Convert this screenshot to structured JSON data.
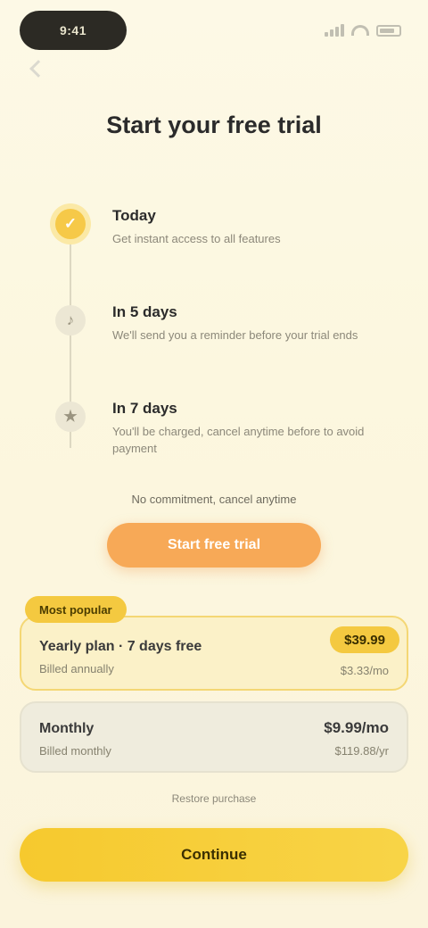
{
  "status_bar": {
    "time": "9:41"
  },
  "title": "Start your free trial",
  "timeline": [
    {
      "icon": "lock-icon",
      "glyph": "✓",
      "title": "Today",
      "desc": "Get instant access to all features",
      "active": true
    },
    {
      "icon": "bell-icon",
      "glyph": "♪",
      "title": "In 5 days",
      "desc": "We'll send you a reminder before your trial ends",
      "active": false
    },
    {
      "icon": "star-icon",
      "glyph": "★",
      "title": "In 7 days",
      "desc": "You'll be charged, cancel anytime before to avoid payment",
      "active": false
    }
  ],
  "note": "No commitment, cancel anytime",
  "cta_label": "Start free trial",
  "plans": {
    "tag": "Most popular",
    "selected": {
      "name": "Yearly plan · 7 days free",
      "sub": "Billed annually",
      "price": "$39.99",
      "price_sub": "$3.33/mo"
    },
    "regular": {
      "name": "Monthly",
      "sub": "Billed monthly",
      "price": "$9.99/mo",
      "price_sub": "$119.88/yr"
    }
  },
  "fine_print": "Restore purchase",
  "main_button": "Continue",
  "colors": {
    "accent": "#f6c948",
    "cta": "#f7a957",
    "background": "#fdf9e6"
  }
}
